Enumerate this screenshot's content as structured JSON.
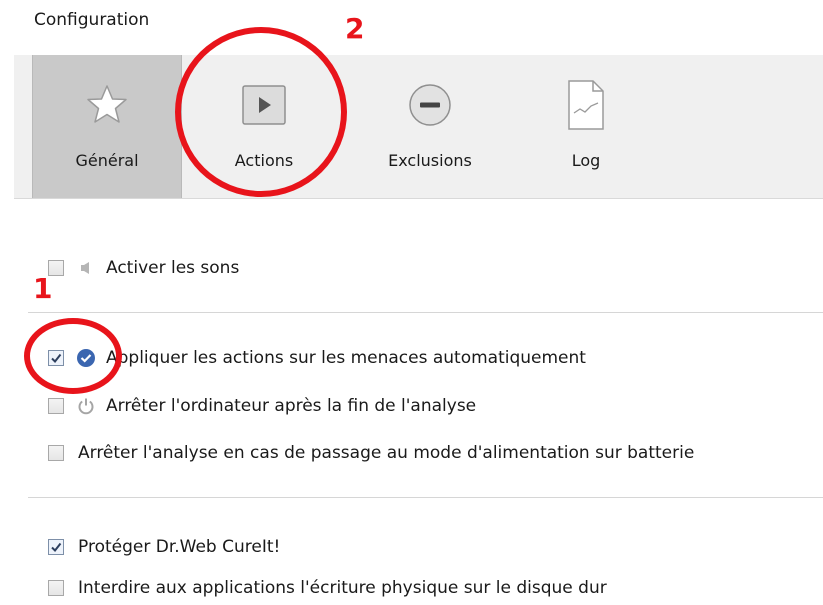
{
  "window": {
    "title": "Configuration"
  },
  "tabs": [
    {
      "id": "general",
      "label": "Général",
      "icon": "star-icon",
      "active": true
    },
    {
      "id": "actions",
      "label": "Actions",
      "icon": "play-icon",
      "active": false
    },
    {
      "id": "exclusions",
      "label": "Exclusions",
      "icon": "minus-circle-icon",
      "active": false
    },
    {
      "id": "log",
      "label": "Log",
      "icon": "document-chart-icon",
      "active": false
    }
  ],
  "options": {
    "sounds": {
      "label": "Activer les sons",
      "checked": false,
      "icon": "speaker-icon"
    },
    "auto_actions": {
      "label": "Appliquer les actions sur les menaces automatiquement",
      "checked": true,
      "icon": "check-circle-icon"
    },
    "shutdown": {
      "label": "Arrêter l'ordinateur après la fin de l'analyse",
      "checked": false,
      "icon": "power-icon"
    },
    "battery": {
      "label": "Arrêter l'analyse en cas de passage au mode d'alimentation sur batterie",
      "checked": false
    },
    "protect": {
      "label": "Protéger Dr.Web CureIt!",
      "checked": true
    },
    "disk_write": {
      "label": "Interdire aux applications l'écriture physique sur le disque dur",
      "checked": false
    }
  },
  "annotations": {
    "one": "1",
    "two": "2",
    "color": "#e8141b"
  },
  "colors": {
    "toolbar_bg": "#f0f0f0",
    "active_tab_bg": "#c9c9c9",
    "check_blue": "#3b66b0"
  }
}
